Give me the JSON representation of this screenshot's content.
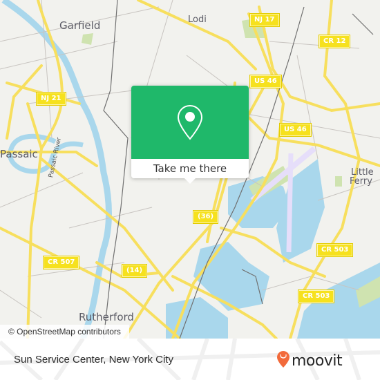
{
  "map": {
    "place_labels": {
      "garfield": "Garfield",
      "lodi": "Lodi",
      "passaic": "Passaic",
      "passaic_river": "Passaic River",
      "little_ferry_line1": "Little",
      "little_ferry_line2": "Ferry",
      "rutherford": "Rutherford"
    },
    "route_shields": {
      "nj21": "NJ 21",
      "nj17": "NJ 17",
      "cr12": "CR 12",
      "us46_a": "US 46",
      "us46_b": "US 46",
      "r36": "(36)",
      "cr503_a": "CR 503",
      "cr503_b": "CR 503",
      "cr507": "CR 507",
      "r14": "(14)"
    },
    "colors": {
      "land": "#f2f2ee",
      "water": "#a9d7ec",
      "park": "#cfe3b0",
      "road_major": "#f7df5e",
      "road_minor": "#c8c4c0",
      "rail": "#707070",
      "airport": "#e6defa"
    }
  },
  "popup": {
    "icon": "map-pin-icon",
    "action_label": "Take me there",
    "accent": "#1fb86a"
  },
  "attribution": "© OpenStreetMap contributors",
  "footer": {
    "location_title": "Sun Service Center, New York City",
    "brand": "moovit",
    "brand_color": "#f26a3b"
  }
}
